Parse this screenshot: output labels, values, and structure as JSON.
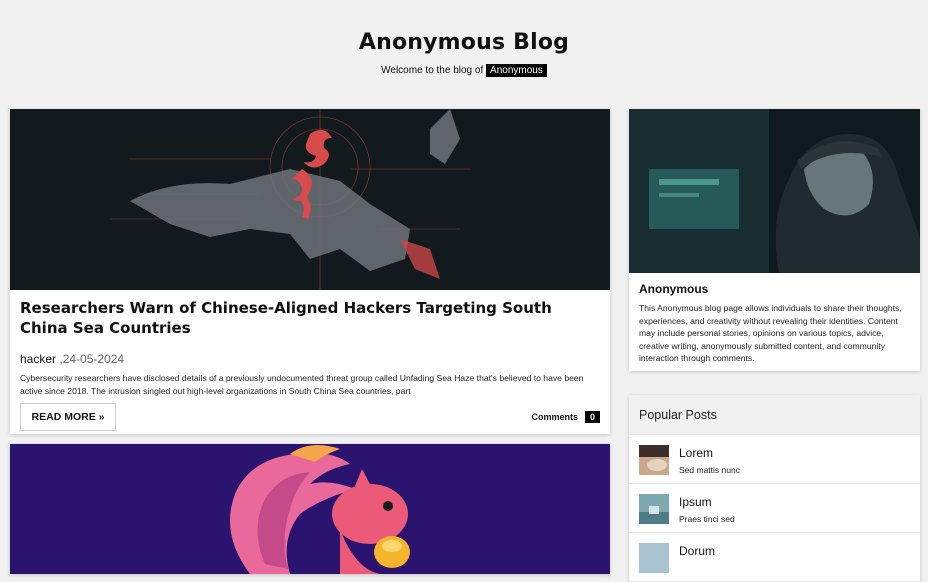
{
  "site": {
    "title": "Anonymous Blog",
    "tagline_prefix": "Welcome to the blog of",
    "tagline_tag": "Anonymous"
  },
  "posts": [
    {
      "title": "Researchers Warn of Chinese-Aligned Hackers Targeting South China Sea Countries",
      "author": "hacker",
      "date": ",24-05-2024",
      "excerpt": "Cybersecurity researchers have disclosed details of a previously undocumented threat group called Unfading Sea Haze that's believed to have been active since 2018. The intrusion singled out high-level organizations in South China Sea countries, part",
      "read_more": "READ MORE »",
      "comments_label": "Comments",
      "comments_count": "0"
    }
  ],
  "about": {
    "name": "Anonymous",
    "text": "This Anonymous blog page allows individuals to share their thoughts, experiences, and creativity without revealing their identities. Content may include personal stories, opinions on various topics, advice, creative writing, anonymously submitted content, and community interaction through comments."
  },
  "popular": {
    "heading": "Popular Posts",
    "items": [
      {
        "title": "Lorem",
        "subtitle": "Sed mattis nunc"
      },
      {
        "title": "Ipsum",
        "subtitle": "Praes tinci sed"
      },
      {
        "title": "Dorum",
        "subtitle": ""
      }
    ]
  },
  "colors": {
    "background": "#f1f1f1",
    "tag_bg": "#000000",
    "dark_image": "#11181c",
    "dragon_red": "#d94a4a",
    "squirrel_bg": "#2b1470"
  }
}
